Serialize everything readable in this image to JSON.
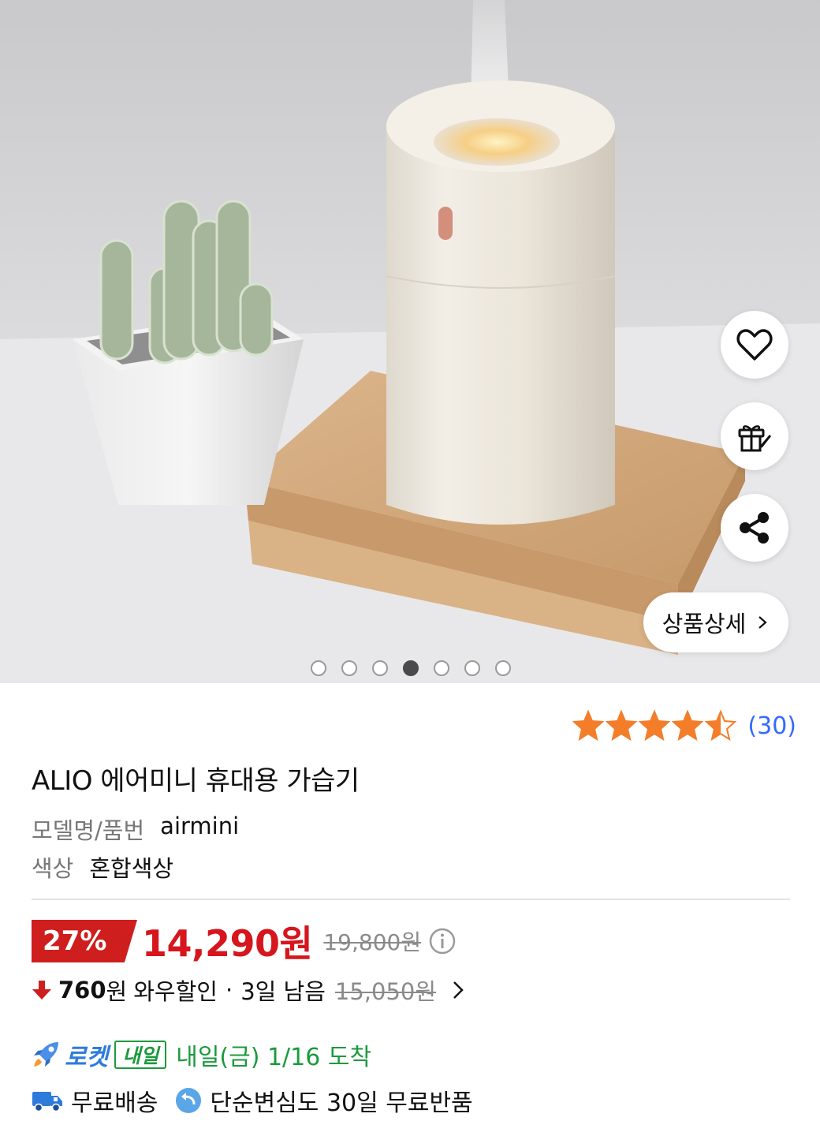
{
  "gallery": {
    "dot_count": 7,
    "active_index": 3,
    "detail_label": "상품상세"
  },
  "rating": {
    "stars": 4.5,
    "review_count": "(30)"
  },
  "product": {
    "title": "ALIO 에어미니 휴대용 가습기",
    "model_key": "모델명/품번",
    "model_value": "airmini",
    "color_key": "색상",
    "color_value": "혼합색상"
  },
  "price": {
    "discount": "27%",
    "sale_price": "14,290원",
    "original_price": "19,800원",
    "wow_amount": "760",
    "wow_won": "원",
    "wow_label": "와우할인",
    "wow_separator": "·",
    "wow_days": "3일 남음",
    "wow_strike": "15,050원"
  },
  "delivery": {
    "rocket_label": "로켓",
    "naeil_badge": "내일",
    "arrival": "내일(금) 1/16 도착",
    "free_shipping": "무료배송",
    "free_return": "단순변심도 30일 무료반품"
  },
  "colors": {
    "accent_red": "#d6151d",
    "badge_red": "#ce1e1e",
    "link_blue": "#346aff",
    "rocket_blue": "#2e7bdc",
    "arrival_green": "#1c9a3c",
    "star_orange": "#f47d2a"
  }
}
